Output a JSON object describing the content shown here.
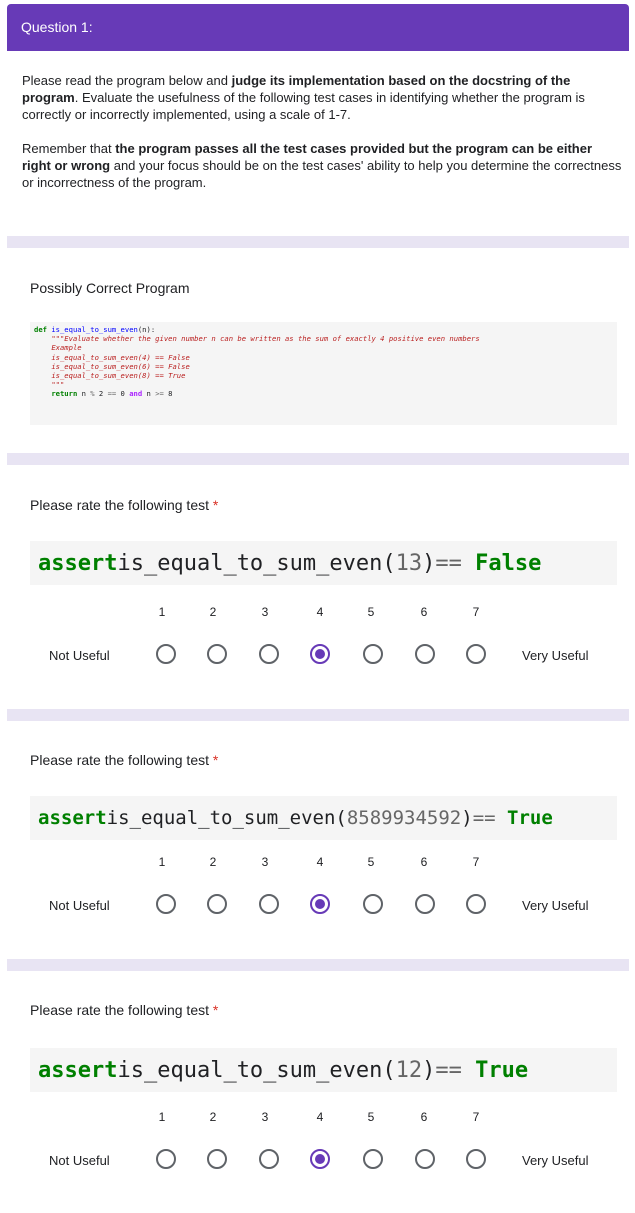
{
  "header": {
    "title": "Question 1:"
  },
  "intro": {
    "p1_a": "Please read the program below and ",
    "p1_b": "judge its implementation based on the docstring of the program",
    "p1_c": ". Evaluate the usefulness of the following test cases in identifying whether the program is correctly or incorrectly implemented, using a scale of 1-7.",
    "p2_a": "Remember that ",
    "p2_b": "the program passes all the test cases provided but the program can be either right or wrong",
    "p2_c": " and your focus should be on the test cases' ability to help you determine the correctness or incorrectness of the program."
  },
  "program": {
    "title": "Possibly Correct Program",
    "code": {
      "def_kw": "def",
      "fn_name": "is_equal_to_sum_even",
      "sig_rest": "(n):",
      "doc_lines": [
        "\"\"\"Evaluate whether the given number n can be written as the sum of exactly 4 positive even numbers",
        "Example",
        "is_equal_to_sum_even(4) == False",
        "is_equal_to_sum_even(6) == False",
        "is_equal_to_sum_even(8) == True",
        "\"\"\""
      ],
      "return_kw": "return",
      "ret_a": " n ",
      "ret_op1": "%",
      "ret_b": " 2 ",
      "ret_op2": "==",
      "ret_c": " 0 ",
      "and_kw": "and",
      "ret_d": " n ",
      "ret_op3": ">=",
      "ret_e": " 8"
    }
  },
  "questions": [
    {
      "prompt": "Please rate the following test",
      "required": "*",
      "assert_kw": "assert",
      "call": " is_equal_to_sum_even(",
      "arg": "13",
      "close": ") ",
      "op": "==",
      "expected": "False",
      "selected": 4
    },
    {
      "prompt": "Please rate the following test",
      "required": "*",
      "assert_kw": "assert",
      "call": " is_equal_to_sum_even(",
      "arg": "8589934592",
      "close": ") ",
      "op": "==",
      "expected": "True",
      "selected": 4
    },
    {
      "prompt": "Please rate the following test",
      "required": "*",
      "assert_kw": "assert",
      "call": " is_equal_to_sum_even(",
      "arg": "12",
      "close": ") ",
      "op": "==",
      "expected": "True",
      "selected": 4
    }
  ],
  "scale": {
    "labels": [
      "1",
      "2",
      "3",
      "4",
      "5",
      "6",
      "7"
    ],
    "low": "Not Useful",
    "high": "Very Useful"
  },
  "colors": {
    "accent": "#673ab7",
    "required": "#d93025",
    "keyword": "#008000"
  }
}
